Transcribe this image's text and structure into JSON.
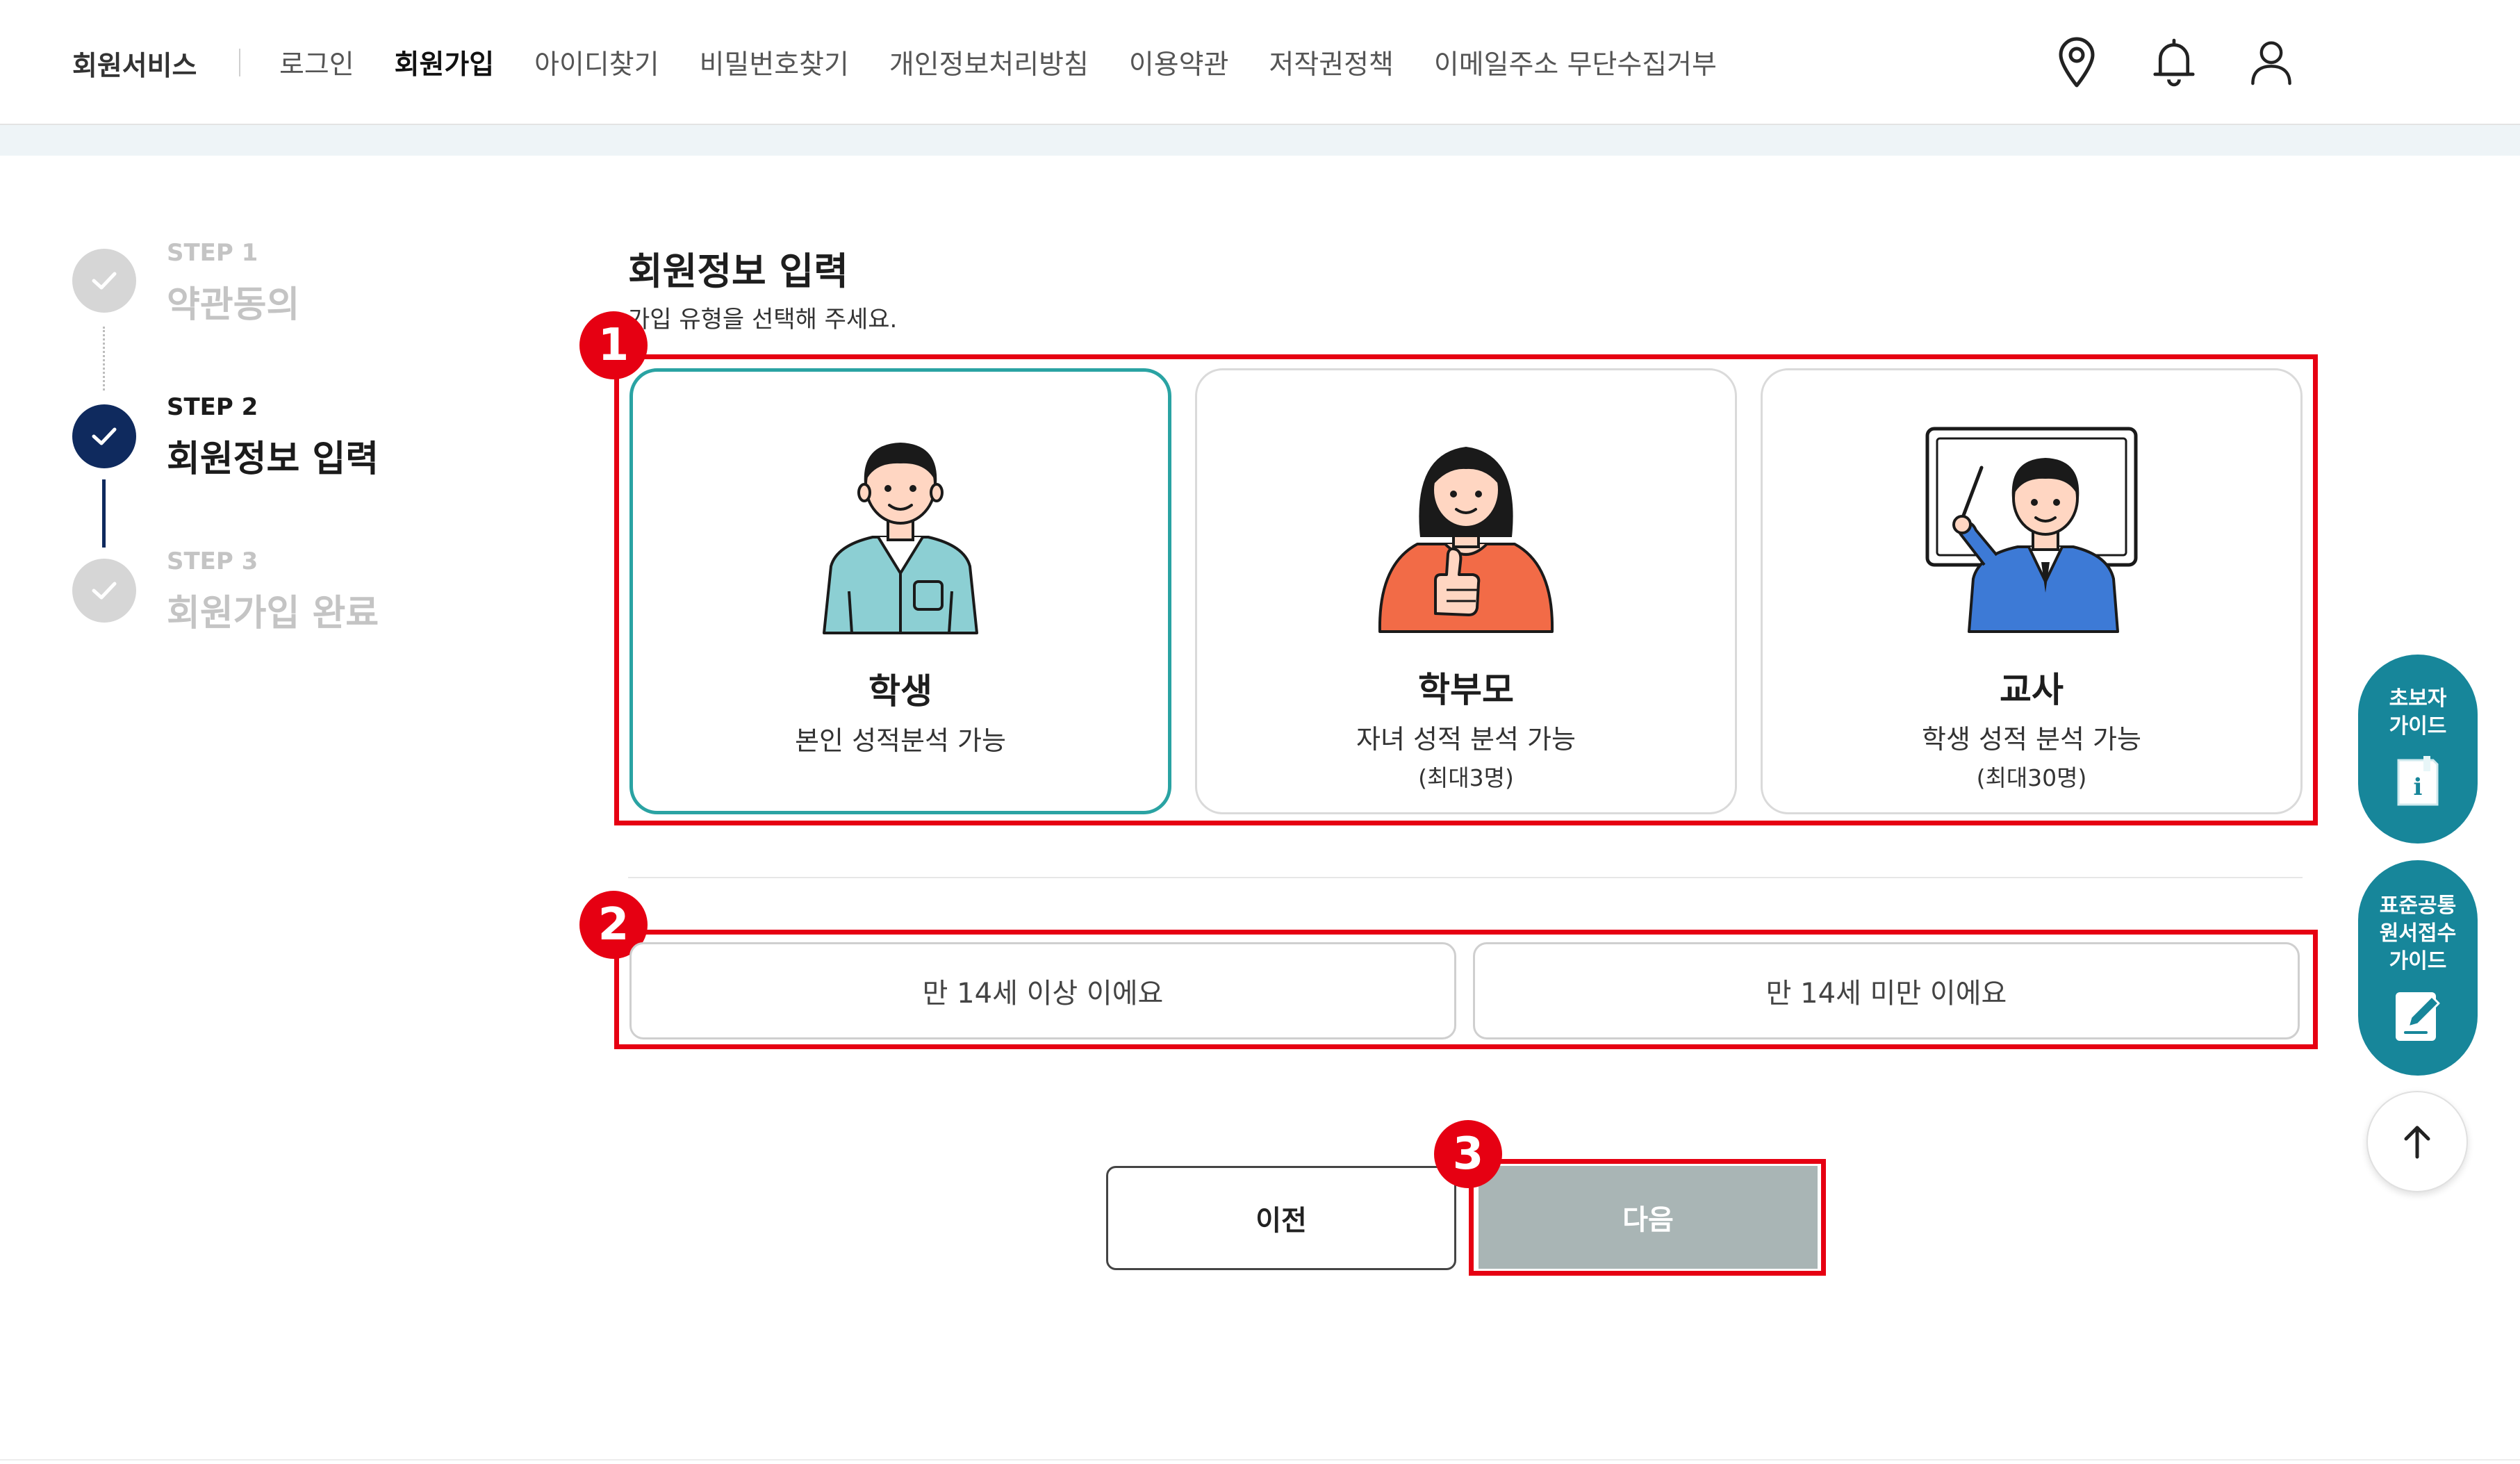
{
  "nav": {
    "title": "회원서비스",
    "links": [
      "로그인",
      "회원가입",
      "아이디찾기",
      "비밀번호찾기",
      "개인정보처리방침",
      "이용약관",
      "저작권정책",
      "이메일주소 무단수집거부"
    ],
    "icons": [
      "location-pin-icon",
      "bell-icon",
      "user-icon"
    ]
  },
  "steps": [
    {
      "step": "STEP 1",
      "label": "약관동의"
    },
    {
      "step": "STEP 2",
      "label": "회원정보 입력"
    },
    {
      "step": "STEP 3",
      "label": "회원가입 완료"
    }
  ],
  "main": {
    "title": "회원정보 입력",
    "subtitle": "가입 유형을 선택해 주세요."
  },
  "cards": [
    {
      "name": "학생",
      "desc": "본인 성적분석 가능",
      "note": ""
    },
    {
      "name": "학부모",
      "desc": "자녀 성적 분석 가능",
      "note": "(최대3명)"
    },
    {
      "name": "교사",
      "desc": "학생 성적 분석 가능",
      "note": "(최대30명)"
    }
  ],
  "age": {
    "over": "만 14세 이상 이에요",
    "under": "만 14세 미만 이에요"
  },
  "buttons": {
    "prev": "이전",
    "next": "다음"
  },
  "badges": [
    "1",
    "2",
    "3"
  ],
  "floating": {
    "guide1_line1": "초보자",
    "guide1_line2": "가이드",
    "guide2_line1": "표준공통",
    "guide2_line2": "원서접수",
    "guide2_line3": "가이드"
  },
  "colors": {
    "step_active": "#0f2a5e",
    "card_selected_border": "#2aa3a3",
    "highlight_red": "#e60012",
    "next_button": "#a9b5b5",
    "floating_teal": "#17869a"
  }
}
